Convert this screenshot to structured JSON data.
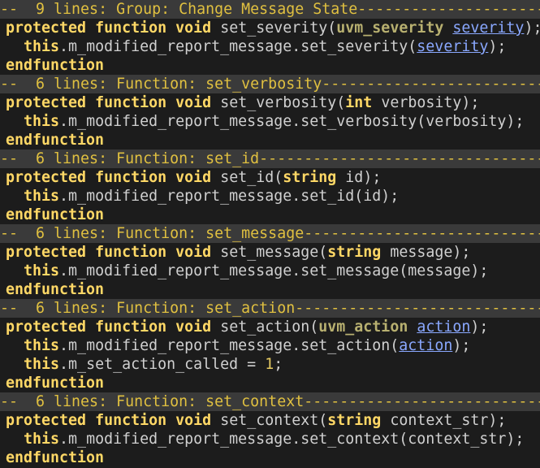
{
  "editor": {
    "lines": [
      {
        "kind": "fold",
        "text": "--  9 lines: Group: Change Message State----------------------"
      },
      {
        "kind": "code",
        "tokens": [
          {
            "t": "protected",
            "c": "kw"
          },
          {
            "t": " "
          },
          {
            "t": "function",
            "c": "kw"
          },
          {
            "t": " "
          },
          {
            "t": "void",
            "c": "kw"
          },
          {
            "t": " set_severity("
          },
          {
            "t": "uvm_severity",
            "c": "ty"
          },
          {
            "t": " "
          },
          {
            "t": "severity",
            "c": "ln"
          },
          {
            "t": ");"
          }
        ]
      },
      {
        "kind": "code",
        "tokens": [
          {
            "t": "  "
          },
          {
            "t": "this",
            "c": "kw"
          },
          {
            "t": ".m_modified_report_message.set_severity("
          },
          {
            "t": "severity",
            "c": "ln"
          },
          {
            "t": ");"
          }
        ]
      },
      {
        "kind": "code",
        "tokens": [
          {
            "t": "endfunction",
            "c": "kw"
          }
        ]
      },
      {
        "kind": "fold",
        "text": "--  6 lines: Function: set_verbosity------------------------------"
      },
      {
        "kind": "code",
        "tokens": [
          {
            "t": "protected",
            "c": "kw"
          },
          {
            "t": " "
          },
          {
            "t": "function",
            "c": "kw"
          },
          {
            "t": " "
          },
          {
            "t": "void",
            "c": "kw"
          },
          {
            "t": " set_verbosity("
          },
          {
            "t": "int",
            "c": "kw"
          },
          {
            "t": " verbosity);"
          }
        ]
      },
      {
        "kind": "code",
        "tokens": [
          {
            "t": "  "
          },
          {
            "t": "this",
            "c": "kw"
          },
          {
            "t": ".m_modified_report_message.set_verbosity(verbosity);"
          }
        ]
      },
      {
        "kind": "code",
        "tokens": [
          {
            "t": "endfunction",
            "c": "kw"
          }
        ]
      },
      {
        "kind": "fold",
        "text": "--  6 lines: Function: set_id-------------------------------------"
      },
      {
        "kind": "code",
        "tokens": [
          {
            "t": "protected",
            "c": "kw"
          },
          {
            "t": " "
          },
          {
            "t": "function",
            "c": "kw"
          },
          {
            "t": " "
          },
          {
            "t": "void",
            "c": "kw"
          },
          {
            "t": " set_id("
          },
          {
            "t": "string",
            "c": "kw"
          },
          {
            "t": " id);"
          }
        ]
      },
      {
        "kind": "code",
        "tokens": [
          {
            "t": "  "
          },
          {
            "t": "this",
            "c": "kw"
          },
          {
            "t": ".m_modified_report_message.set_id(id);"
          }
        ]
      },
      {
        "kind": "code",
        "tokens": [
          {
            "t": "endfunction",
            "c": "kw"
          }
        ]
      },
      {
        "kind": "fold",
        "text": "--  6 lines: Function: set_message--------------------------------"
      },
      {
        "kind": "code",
        "tokens": [
          {
            "t": "protected",
            "c": "kw"
          },
          {
            "t": " "
          },
          {
            "t": "function",
            "c": "kw"
          },
          {
            "t": " "
          },
          {
            "t": "void",
            "c": "kw"
          },
          {
            "t": " set_message("
          },
          {
            "t": "string",
            "c": "kw"
          },
          {
            "t": " message);"
          }
        ]
      },
      {
        "kind": "code",
        "tokens": [
          {
            "t": "  "
          },
          {
            "t": "this",
            "c": "kw"
          },
          {
            "t": ".m_modified_report_message.set_message(message);"
          }
        ]
      },
      {
        "kind": "code",
        "tokens": [
          {
            "t": "endfunction",
            "c": "kw"
          }
        ]
      },
      {
        "kind": "fold",
        "text": "--  6 lines: Function: set_action---------------------------------"
      },
      {
        "kind": "code",
        "tokens": [
          {
            "t": "protected",
            "c": "kw"
          },
          {
            "t": " "
          },
          {
            "t": "function",
            "c": "kw"
          },
          {
            "t": " "
          },
          {
            "t": "void",
            "c": "kw"
          },
          {
            "t": " set_action("
          },
          {
            "t": "uvm_action",
            "c": "ty"
          },
          {
            "t": " "
          },
          {
            "t": "action",
            "c": "ln"
          },
          {
            "t": ");"
          }
        ]
      },
      {
        "kind": "code",
        "tokens": [
          {
            "t": "  "
          },
          {
            "t": "this",
            "c": "kw"
          },
          {
            "t": ".m_modified_report_message.set_action("
          },
          {
            "t": "action",
            "c": "ln"
          },
          {
            "t": ");"
          }
        ]
      },
      {
        "kind": "code",
        "tokens": [
          {
            "t": "  "
          },
          {
            "t": "this",
            "c": "kw"
          },
          {
            "t": ".m_set_action_called = "
          },
          {
            "t": "1",
            "c": "nm"
          },
          {
            "t": ";"
          }
        ]
      },
      {
        "kind": "code",
        "tokens": [
          {
            "t": "endfunction",
            "c": "kw"
          }
        ]
      },
      {
        "kind": "fold",
        "text": "--  6 lines: Function: set_context--------------------------------"
      },
      {
        "kind": "code",
        "tokens": [
          {
            "t": "protected",
            "c": "kw"
          },
          {
            "t": " "
          },
          {
            "t": "function",
            "c": "kw"
          },
          {
            "t": " "
          },
          {
            "t": "void",
            "c": "kw"
          },
          {
            "t": " set_context("
          },
          {
            "t": "string",
            "c": "kw"
          },
          {
            "t": " context_str);"
          }
        ]
      },
      {
        "kind": "code",
        "tokens": [
          {
            "t": "  "
          },
          {
            "t": "this",
            "c": "kw"
          },
          {
            "t": ".m_modified_report_message.set_context(context_str);"
          }
        ]
      },
      {
        "kind": "code",
        "tokens": [
          {
            "t": "endfunction",
            "c": "kw"
          }
        ]
      }
    ]
  },
  "colors": {
    "background": "#1c1c1c",
    "fold_background": "#3a3a3a",
    "fold_text": "#e0c040",
    "keyword": "#ffd866",
    "type": "#b8b070",
    "link": "#8aa8ff",
    "number": "#e8cc62",
    "plain": "#d0d0d0"
  }
}
